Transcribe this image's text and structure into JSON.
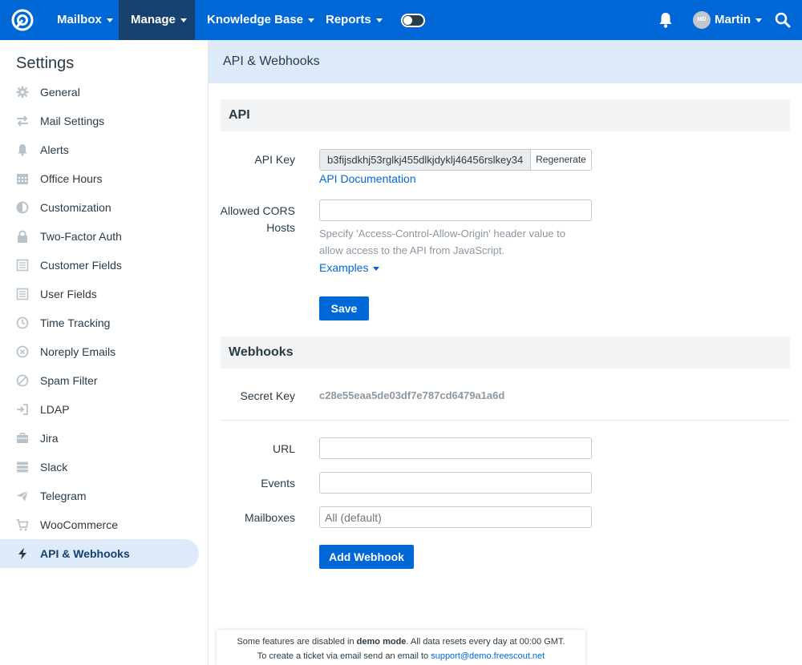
{
  "navbar": {
    "items": [
      {
        "label": "Mailbox",
        "active": false
      },
      {
        "label": "Manage",
        "active": true
      },
      {
        "label": "Knowledge Base",
        "active": false
      },
      {
        "label": "Reports",
        "active": false
      }
    ],
    "user_initials": "MD",
    "user_name": "Martin",
    "accent_color": "#0068d6"
  },
  "sidebar": {
    "title": "Settings",
    "items": [
      {
        "label": "General",
        "icon": "gear-icon"
      },
      {
        "label": "Mail Settings",
        "icon": "arrows-icon"
      },
      {
        "label": "Alerts",
        "icon": "bell-icon"
      },
      {
        "label": "Office Hours",
        "icon": "calendar-icon"
      },
      {
        "label": "Customization",
        "icon": "contrast-icon"
      },
      {
        "label": "Two-Factor Auth",
        "icon": "lock-icon"
      },
      {
        "label": "Customer Fields",
        "icon": "list-icon"
      },
      {
        "label": "User Fields",
        "icon": "list-icon"
      },
      {
        "label": "Time Tracking",
        "icon": "clock-icon"
      },
      {
        "label": "Noreply Emails",
        "icon": "x-circle-icon"
      },
      {
        "label": "Spam Filter",
        "icon": "ban-icon"
      },
      {
        "label": "LDAP",
        "icon": "login-icon"
      },
      {
        "label": "Jira",
        "icon": "briefcase-icon"
      },
      {
        "label": "Slack",
        "icon": "stack-icon"
      },
      {
        "label": "Telegram",
        "icon": "send-icon"
      },
      {
        "label": "WooCommerce",
        "icon": "cart-icon"
      },
      {
        "label": "API & Webhooks",
        "icon": "bolt-icon",
        "active": true
      }
    ]
  },
  "main": {
    "header": "API & Webhooks",
    "api": {
      "title": "API",
      "key_label": "API Key",
      "key_value": "b3fijsdkhj53rglkj455dlkjdyklj46456rslkey34",
      "regenerate_label": "Regenerate",
      "docs_link": "API Documentation",
      "cors_label_1": "Allowed CORS",
      "cors_label_2": "Hosts",
      "cors_value": "",
      "cors_help": "Specify 'Access-Control-Allow-Origin' header value to allow access to the API from JavaScript.",
      "examples_label": "Examples",
      "save_label": "Save"
    },
    "webhooks": {
      "title": "Webhooks",
      "secret_label": "Secret Key",
      "secret_value": "c28e55eaa5de03df7e787cd6479a1a6d",
      "url_label": "URL",
      "url_value": "",
      "events_label": "Events",
      "events_value": "",
      "mailboxes_label": "Mailboxes",
      "mailboxes_placeholder": "All (default)",
      "add_label": "Add Webhook"
    }
  },
  "demo_notice": {
    "line1_pre": "Some features are disabled in ",
    "line1_bold": "demo mode",
    "line1_post": ". All data resets every day at 00:00 GMT.",
    "line2_pre": "To create a ticket via email send an email to ",
    "line2_link": "support@demo.freescout.net"
  }
}
